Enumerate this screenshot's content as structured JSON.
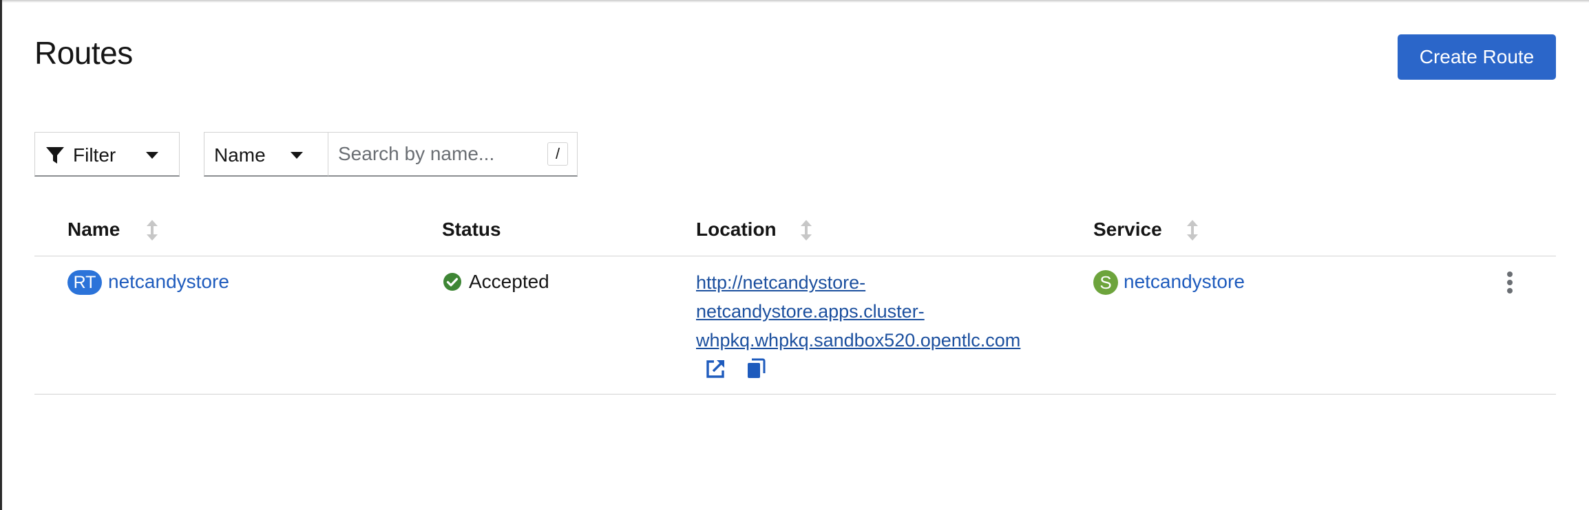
{
  "page": {
    "title": "Routes",
    "create_button": "Create Route"
  },
  "toolbar": {
    "filter_label": "Filter",
    "name_select": "Name",
    "search_placeholder": "Search by name...",
    "search_value": "",
    "shortcut_key": "/"
  },
  "table": {
    "columns": {
      "name": "Name",
      "status": "Status",
      "location": "Location",
      "service": "Service"
    },
    "rows": [
      {
        "badge": "RT",
        "name": "netcandystore",
        "status": "Accepted",
        "location_lines": [
          "http://netcandystore-",
          "netcandystore.apps.cluster-",
          "whpkq.whpkq.sandbox520.opentlc.com"
        ],
        "service_badge": "S",
        "service": "netcandystore"
      }
    ]
  },
  "colors": {
    "primary": "#2b66c9",
    "link": "#1e5bbd",
    "route_badge": "#2b73d9",
    "service_badge": "#6da43c",
    "status_ok": "#3e8635"
  },
  "icons": [
    "filter-icon",
    "caret-down-icon",
    "sort-icon",
    "check-circle-icon",
    "external-link-icon",
    "copy-icon",
    "kebab-icon"
  ]
}
